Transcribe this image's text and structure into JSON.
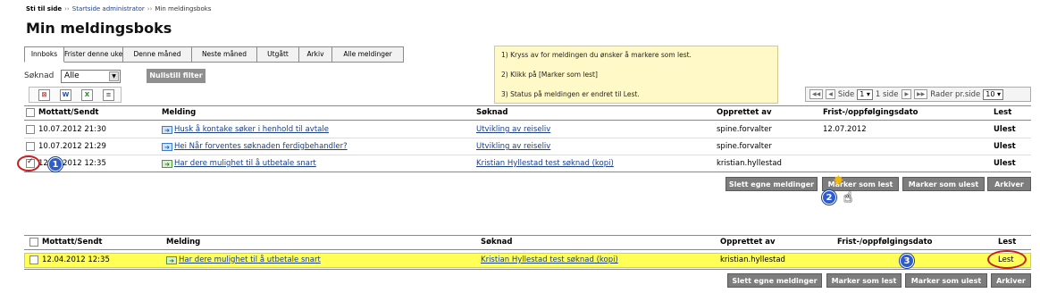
{
  "breadcrumb": {
    "home": "Sti til side",
    "sep": "››",
    "items": [
      "Startside administrator",
      "Min meldingsboks"
    ]
  },
  "page_title": "Min meldingsboks",
  "tabs": [
    "Innboks",
    "Frister denne uke",
    "Denne måned",
    "Neste måned",
    "Utgått",
    "Arkiv",
    "Alle meldinger"
  ],
  "instructions": [
    "1) Kryss av for meldingen du ønsker å markere som lest.",
    "2) Klikk på [Marker som lest]",
    "3) Status på meldingen er endret til Lest."
  ],
  "filter": {
    "label": "Søknad",
    "value": "Alle",
    "reset_label": "Nullstill filter"
  },
  "export_icons": [
    "pdf-icon",
    "word-icon",
    "excel-icon",
    "csv-icon"
  ],
  "pager": {
    "side_label": "Side",
    "page": "1",
    "of": "1 side",
    "rows_label": "Rader pr.side",
    "rows": "10"
  },
  "columns": [
    "Mottatt/Sendt",
    "Melding",
    "Søknad",
    "Opprettet av",
    "Frist-/oppfølgingsdato",
    "Lest"
  ],
  "rows": [
    {
      "date": "10.07.2012 21:30",
      "message": "Husk å kontake søker i henhold til avtale",
      "application": "Utvikling av reiseliv",
      "created_by": "spine.forvalter",
      "deadline": "12.07.2012",
      "status": "Ulest"
    },
    {
      "date": "10.07.2012 21:29",
      "message": "Hei Når forventes søknaden ferdigbehandler?",
      "application": "Utvikling av reiseliv",
      "created_by": "spine.forvalter",
      "deadline": "",
      "status": "Ulest"
    },
    {
      "date": "12.04.2012 12:35",
      "message": "Har dere mulighet til å utbetale snart",
      "application": "Kristian Hyllestad test søknad (kopi)",
      "created_by": "kristian.hyllestad",
      "deadline": "",
      "status": "Ulest"
    }
  ],
  "result_row": {
    "date": "12.04.2012 12:35",
    "message": "Har dere mulighet til å utbetale snart",
    "application": "Kristian Hyllestad test søknad (kopi)",
    "created_by": "kristian.hyllestad",
    "deadline": "",
    "status": "Lest"
  },
  "actions": {
    "delete": "Slett egne meldinger",
    "mark_read": "Marker som lest",
    "mark_unread": "Marker som ulest",
    "archive": "Arkiver"
  },
  "annotations": [
    "1",
    "2",
    "3"
  ],
  "colors": {
    "link": "#1a3f8a",
    "highlight_row": "#ffff55",
    "instruction_bg": "#fff9c8",
    "annotation": "#2d5ccf",
    "ring": "#c42020"
  }
}
